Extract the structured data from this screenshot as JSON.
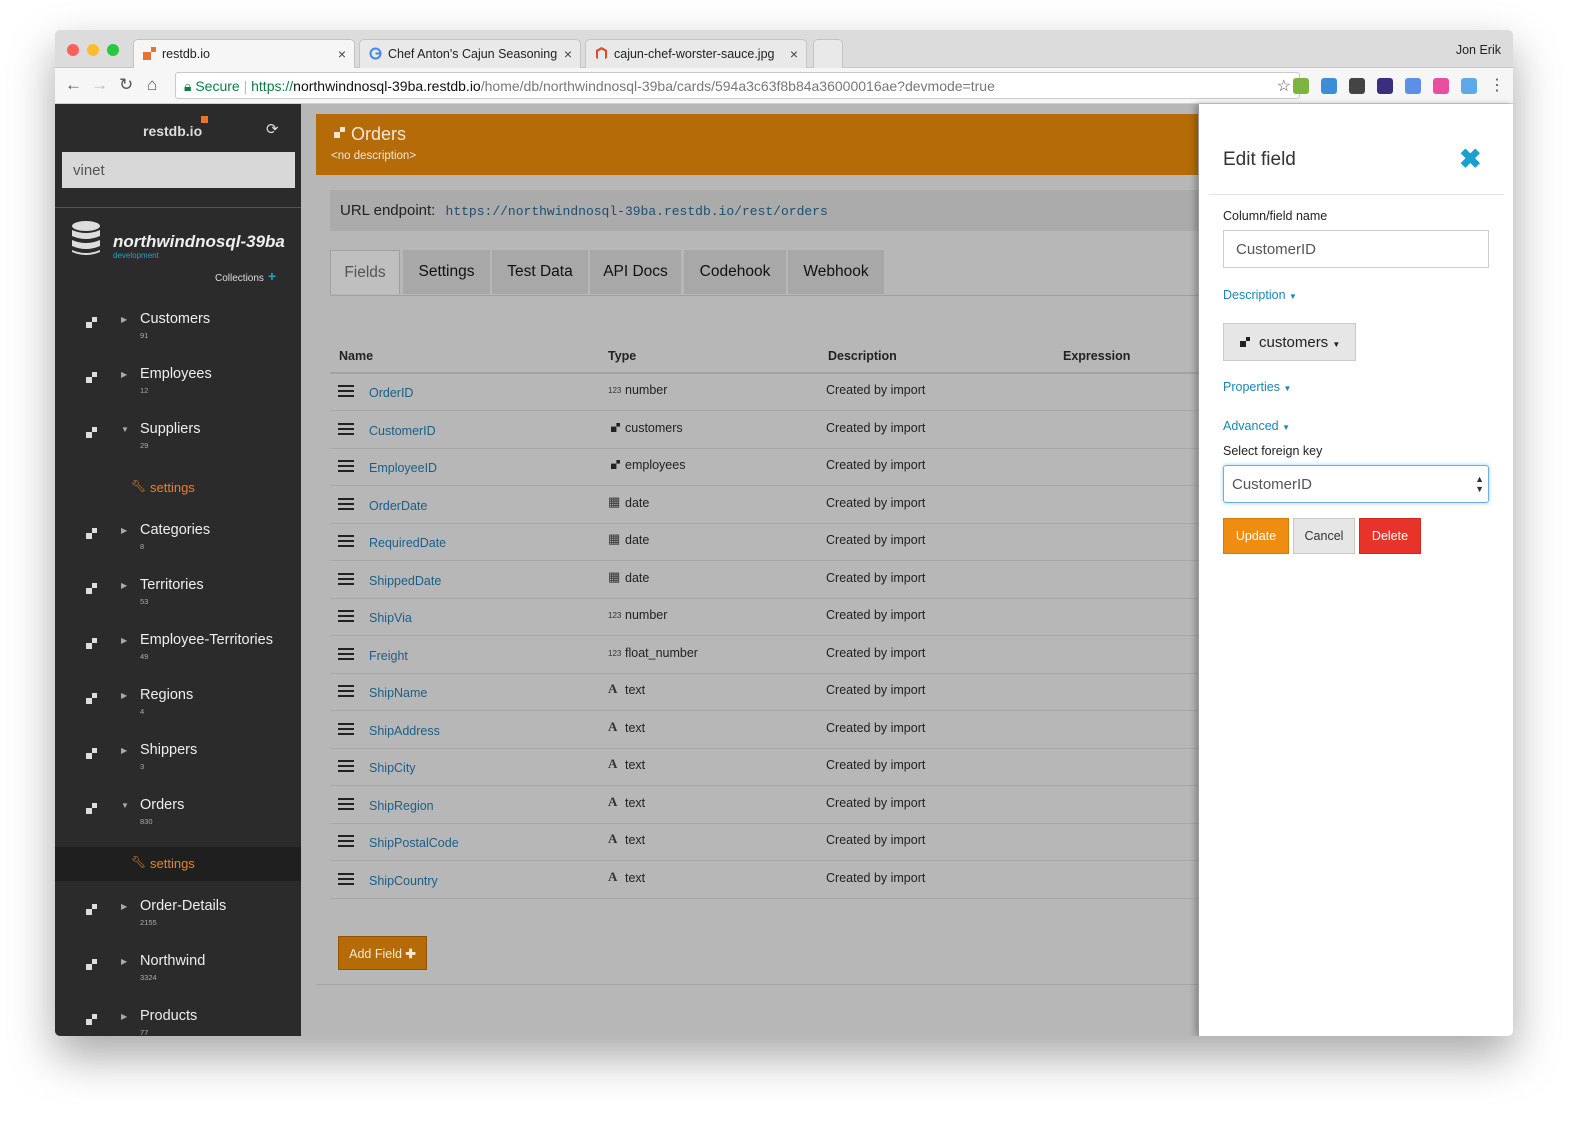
{
  "browser": {
    "profile": "Jon Erik",
    "tabs": [
      {
        "title": "restdb.io",
        "active": true
      },
      {
        "title": "Chef Anton's Cajun Seasoning",
        "active": false
      },
      {
        "title": "cajun-chef-worster-sauce.jpg",
        "active": false
      }
    ],
    "secure_label": "Secure",
    "url_scheme": "https://",
    "url_host": "northwindnosql-39ba.restdb.io",
    "url_path": "/home/db/northwindnosql-39ba/cards/594a3c63f8b84a36000016ae?devmode=true"
  },
  "sidebar": {
    "brand": "restdb.io",
    "search_value": "vinet",
    "db_name": "northwindnosql-39ba",
    "db_env": "development",
    "collections_label": "Collections",
    "settings_label": "settings",
    "collections": [
      {
        "name": "Customers",
        "count": "91",
        "expanded": false
      },
      {
        "name": "Employees",
        "count": "12",
        "expanded": false
      },
      {
        "name": "Suppliers",
        "count": "29",
        "expanded": true
      },
      {
        "name": "Categories",
        "count": "8",
        "expanded": false
      },
      {
        "name": "Territories",
        "count": "53",
        "expanded": false
      },
      {
        "name": "Employee-Territories",
        "count": "49",
        "expanded": false
      },
      {
        "name": "Regions",
        "count": "4",
        "expanded": false
      },
      {
        "name": "Shippers",
        "count": "3",
        "expanded": false
      },
      {
        "name": "Orders",
        "count": "830",
        "expanded": true
      },
      {
        "name": "Order-Details",
        "count": "2155",
        "expanded": false
      },
      {
        "name": "Northwind",
        "count": "3324",
        "expanded": false
      },
      {
        "name": "Products",
        "count": "77",
        "expanded": false
      }
    ]
  },
  "main": {
    "title": "Orders",
    "description": "<no description>",
    "endpoint_label": "URL endpoint:",
    "endpoint_url": "https://northwindnosql-39ba.restdb.io/rest/orders",
    "tabs": [
      "Fields",
      "Settings",
      "Test Data",
      "API Docs",
      "Codehook",
      "Webhook"
    ],
    "columns": {
      "name": "Name",
      "type": "Type",
      "description": "Description",
      "expression": "Expression"
    },
    "fields": [
      {
        "name": "OrderID",
        "icon": "123",
        "type": "number",
        "description": "Created by import"
      },
      {
        "name": "CustomerID",
        "icon": "link",
        "type": "customers",
        "description": "Created by import"
      },
      {
        "name": "EmployeeID",
        "icon": "link",
        "type": "employees",
        "description": "Created by import"
      },
      {
        "name": "OrderDate",
        "icon": "calendar",
        "type": "date",
        "description": "Created by import"
      },
      {
        "name": "RequiredDate",
        "icon": "calendar",
        "type": "date",
        "description": "Created by import"
      },
      {
        "name": "ShippedDate",
        "icon": "calendar",
        "type": "date",
        "description": "Created by import"
      },
      {
        "name": "ShipVia",
        "icon": "123",
        "type": "number",
        "description": "Created by import"
      },
      {
        "name": "Freight",
        "icon": "123",
        "type": "float_number",
        "description": "Created by import"
      },
      {
        "name": "ShipName",
        "icon": "A",
        "type": "text",
        "description": "Created by import"
      },
      {
        "name": "ShipAddress",
        "icon": "A",
        "type": "text",
        "description": "Created by import"
      },
      {
        "name": "ShipCity",
        "icon": "A",
        "type": "text",
        "description": "Created by import"
      },
      {
        "name": "ShipRegion",
        "icon": "A",
        "type": "text",
        "description": "Created by import"
      },
      {
        "name": "ShipPostalCode",
        "icon": "A",
        "type": "text",
        "description": "Created by import"
      },
      {
        "name": "ShipCountry",
        "icon": "A",
        "type": "text",
        "description": "Created by import"
      }
    ],
    "add_field_label": "Add Field"
  },
  "panel": {
    "title": "Edit field",
    "field_name_label": "Column/field name",
    "field_name_value": "CustomerID",
    "description_link": "Description",
    "reference_label": "customers",
    "properties_link": "Properties",
    "advanced_link": "Advanced",
    "foreign_key_label": "Select foreign key",
    "foreign_key_value": "CustomerID",
    "update_label": "Update",
    "cancel_label": "Cancel",
    "delete_label": "Delete"
  },
  "colors": {
    "accent_orange": "#b56c08",
    "link_blue": "#1b5f88",
    "close_blue": "#1a9fce",
    "update_orange": "#ee8d12",
    "delete_red": "#e8332b",
    "settings_orange": "#e8822c"
  }
}
